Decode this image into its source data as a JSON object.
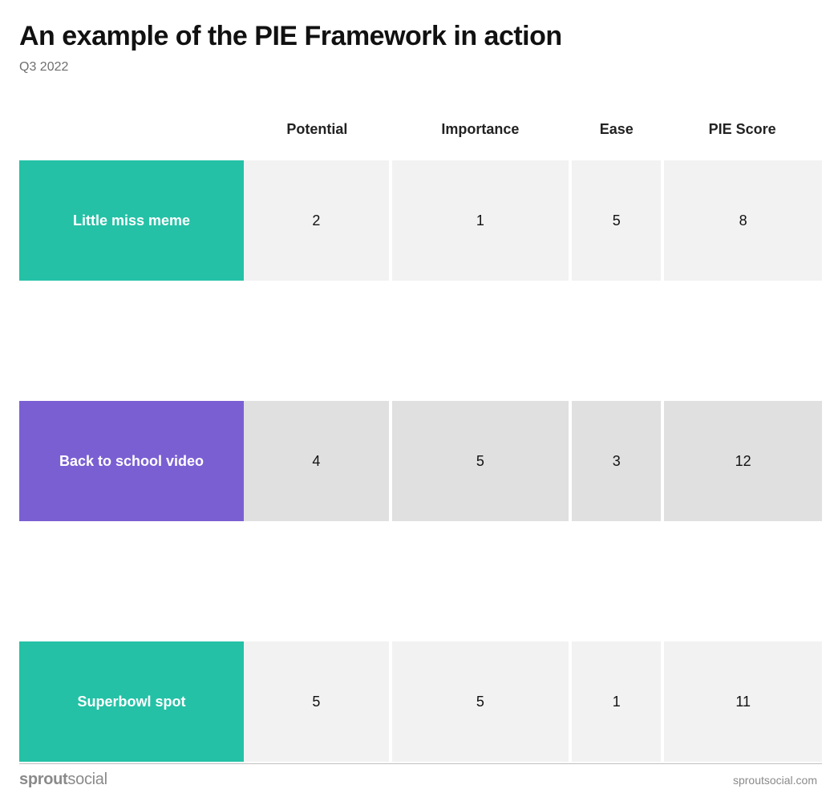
{
  "title": "An example of the PIE Framework in action",
  "subtitle": "Q3 2022",
  "columns": [
    "Potential",
    "Importance",
    "Ease",
    "PIE Score"
  ],
  "rows": [
    {
      "name": "Little miss meme",
      "color": "teal",
      "values": [
        2,
        1,
        5,
        8
      ]
    },
    {
      "name": "Back to school video",
      "color": "purple",
      "values": [
        4,
        5,
        3,
        12
      ]
    },
    {
      "name": "Superbowl spot",
      "color": "teal",
      "values": [
        5,
        5,
        1,
        11
      ]
    }
  ],
  "brand_bold": "sprout",
  "brand_rest": "social",
  "site": "sproutsocial.com",
  "chart_data": {
    "type": "table",
    "title": "An example of the PIE Framework in action",
    "subtitle": "Q3 2022",
    "columns": [
      "Potential",
      "Importance",
      "Ease",
      "PIE Score"
    ],
    "rows": [
      {
        "name": "Little miss meme",
        "values": [
          2,
          1,
          5,
          8
        ]
      },
      {
        "name": "Back to school video",
        "values": [
          4,
          5,
          3,
          12
        ]
      },
      {
        "name": "Superbowl spot",
        "values": [
          5,
          5,
          1,
          11
        ]
      }
    ]
  }
}
